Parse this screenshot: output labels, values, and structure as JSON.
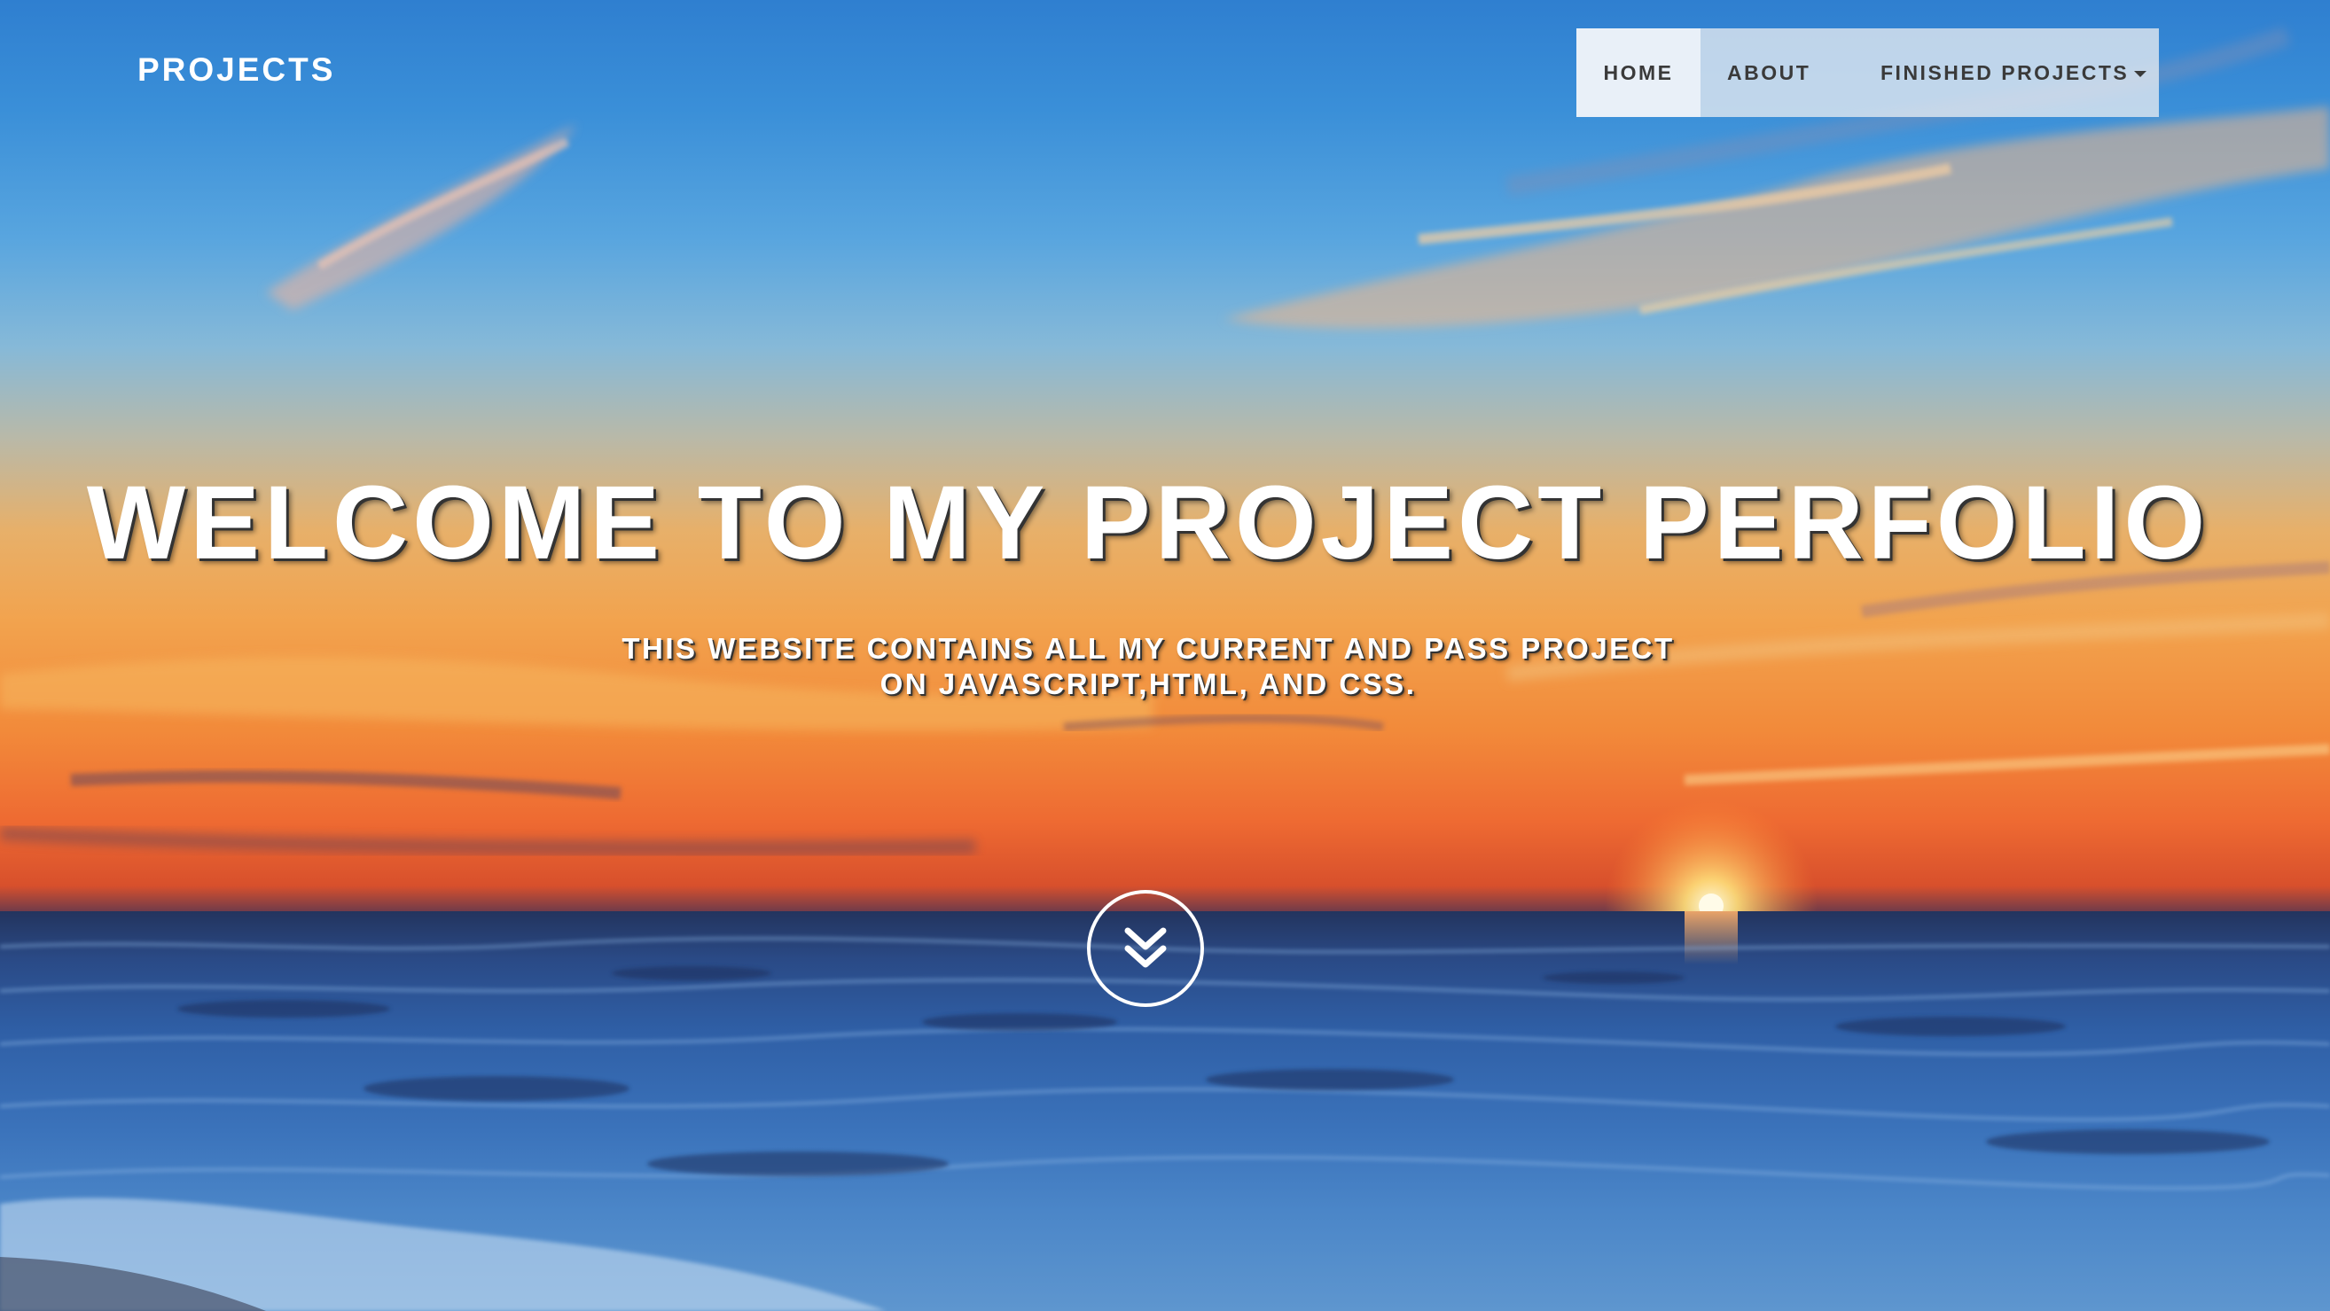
{
  "brand": {
    "label": "PROJECTS"
  },
  "nav": {
    "items": [
      {
        "label": "HOME",
        "active": true
      },
      {
        "label": "ABOUT",
        "active": false
      },
      {
        "label": "FINISHED PROJECTS",
        "active": false,
        "dropdown": true
      }
    ]
  },
  "hero": {
    "title": "WELCOME TO MY PROJECT PERFOLIO",
    "subtitle_line1": "THIS WEBSITE CONTAINS ALL MY CURRENT AND PASS PROJECT",
    "subtitle_line2": "ON JAVASCRIPT,HTML, AND CSS."
  },
  "icons": {
    "scroll_down": "double-chevron-down-icon",
    "dropdown": "caret-down-icon"
  },
  "colors": {
    "nav_background": "#e2e8f0",
    "nav_text": "#3a3a3a",
    "hero_text": "#ffffff",
    "brand_text": "#ffffff"
  }
}
